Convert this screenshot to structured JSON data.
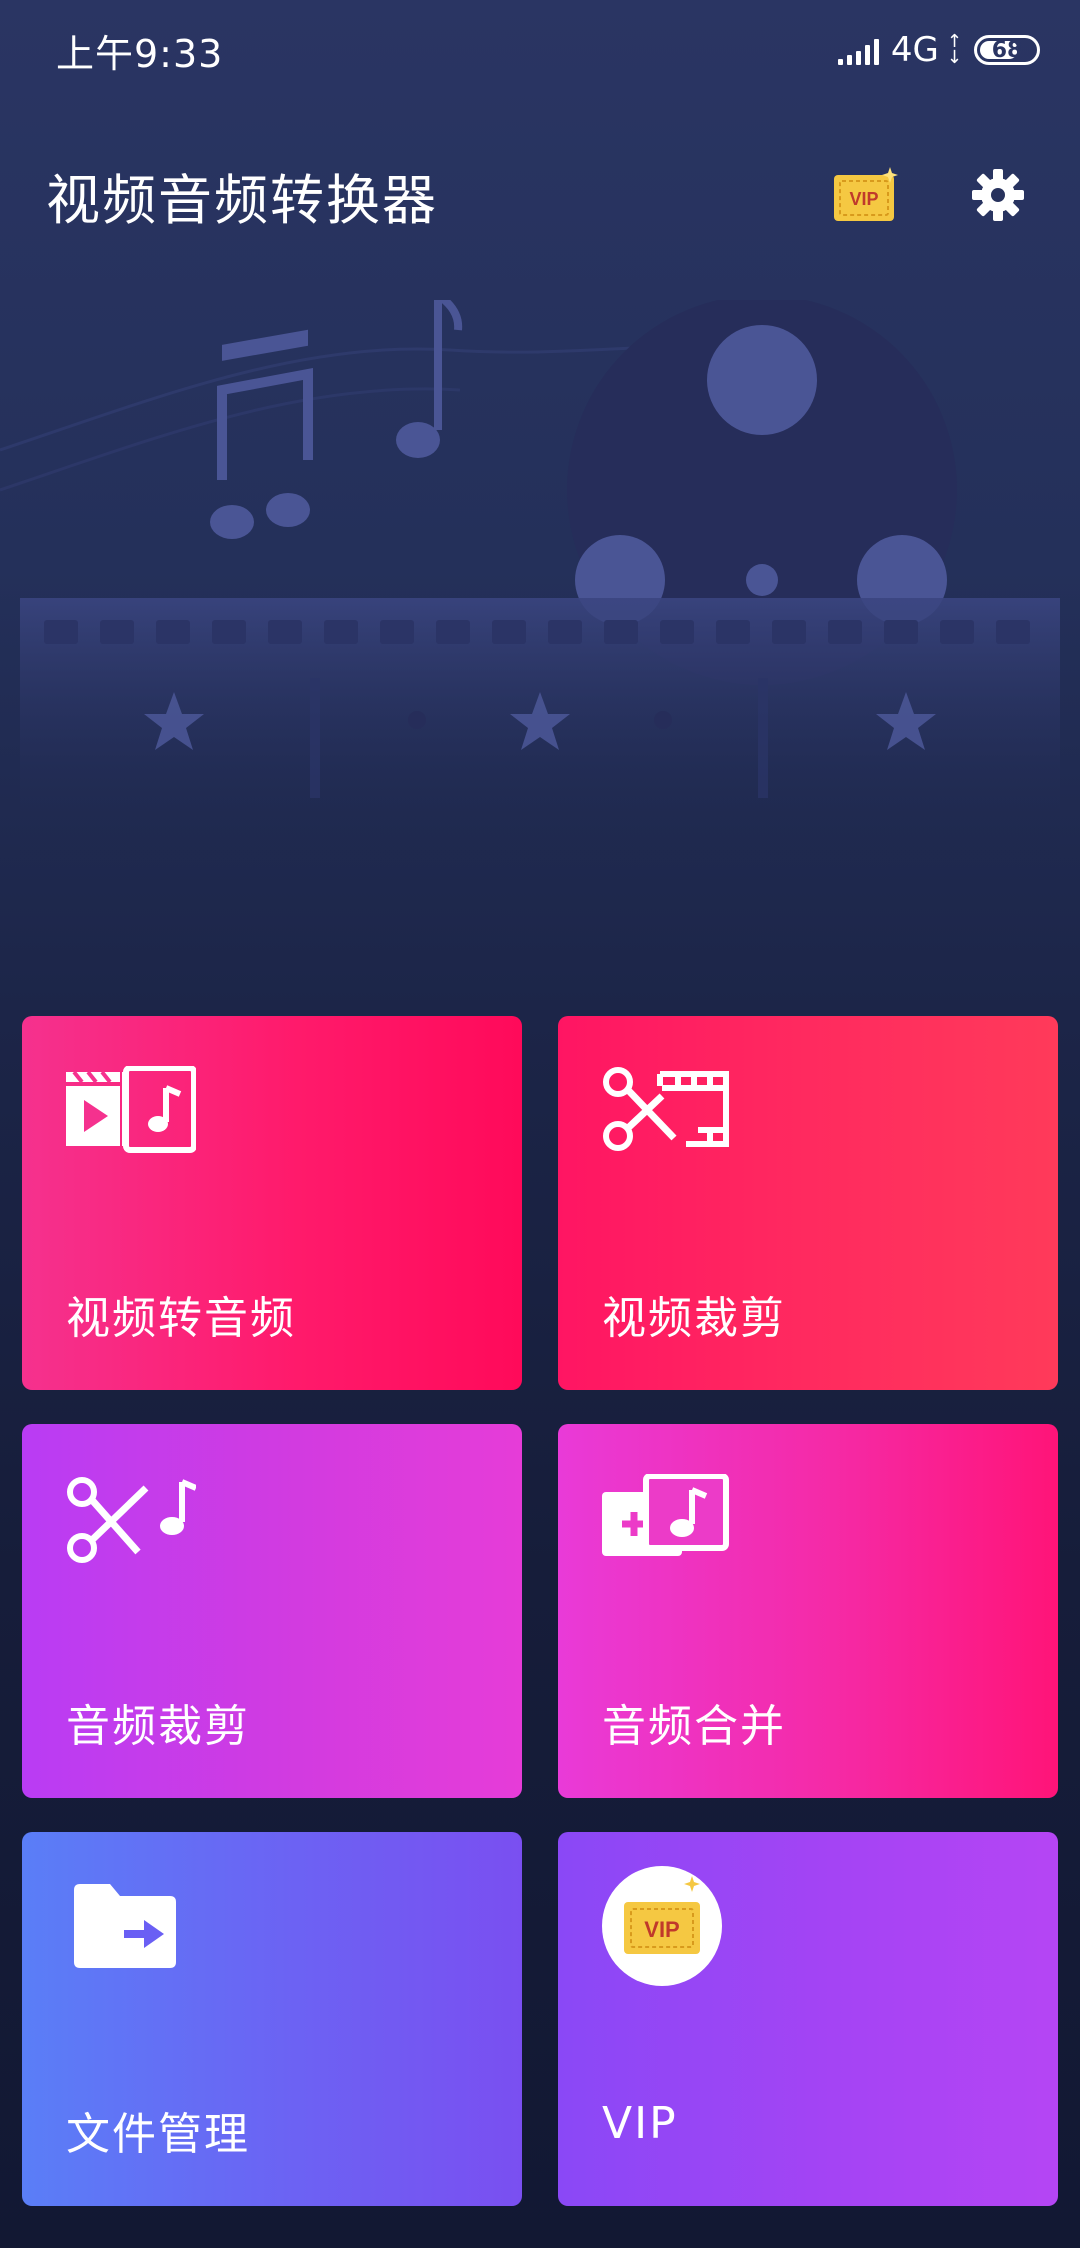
{
  "status_bar": {
    "time": "上午9:33",
    "network": "4G",
    "battery": "68"
  },
  "header": {
    "title": "视频音频转换器",
    "vip_icon": "vip-ticket-icon",
    "settings_icon": "gear-icon"
  },
  "tiles": [
    {
      "label": "视频转音频",
      "icon": "video-to-audio-icon"
    },
    {
      "label": "视频裁剪",
      "icon": "video-cut-icon"
    },
    {
      "label": "音频裁剪",
      "icon": "audio-cut-icon"
    },
    {
      "label": "音频合并",
      "icon": "audio-merge-icon"
    },
    {
      "label": "文件管理",
      "icon": "folder-icon"
    },
    {
      "label": "VIP",
      "icon": "vip-badge-icon"
    }
  ],
  "colors": {
    "background_top": "#2a3563",
    "background_bottom": "#121833",
    "vip_gold": "#f5c842"
  }
}
